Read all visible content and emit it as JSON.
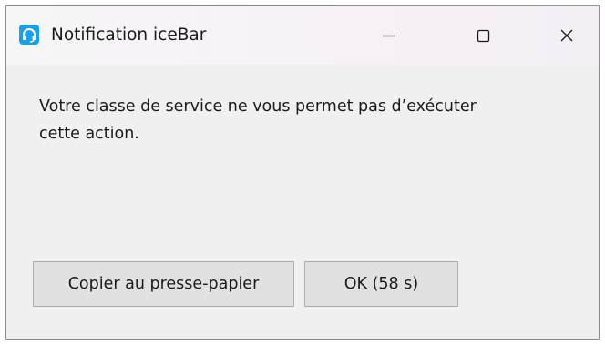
{
  "window": {
    "title": "Notification iceBar",
    "app_icon": "headset-icon",
    "controls": {
      "minimize_icon": "minimize-icon",
      "maximize_icon": "maximize-icon",
      "close_icon": "close-icon"
    }
  },
  "message": {
    "line1": "Votre classe de service ne vous permet pas d’exécuter",
    "line2": "cette action."
  },
  "buttons": {
    "copy_label": "Copier au presse-papier",
    "ok_label": "OK (58 s)"
  },
  "colors": {
    "icon_accent": "#1e9ee3",
    "window_background": "#f0f0f0",
    "button_background": "#e1e1e1"
  }
}
